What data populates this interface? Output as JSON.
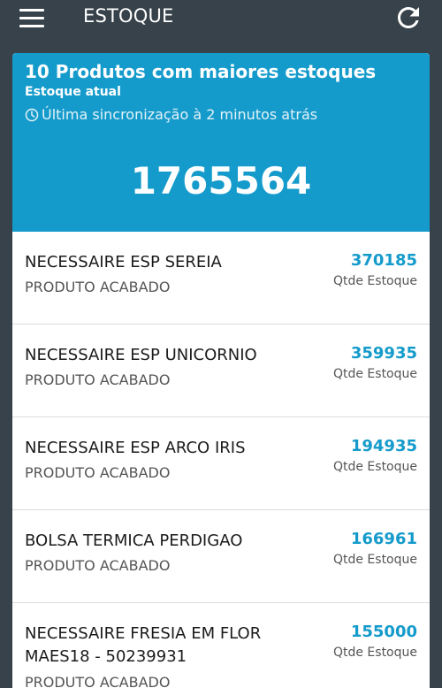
{
  "app": {
    "title": "ESTOQUE",
    "menu_icon": "hamburger-menu-icon",
    "refresh_icon": "refresh-icon"
  },
  "card": {
    "title": "10 Produtos com maiores estoques",
    "subtitle": "Estoque atual",
    "sync_text": "Última sincronização à 2 minutos atrás",
    "sync_icon": "clock-icon",
    "total": "1765564",
    "header_color": "#159bcb"
  },
  "products": [
    {
      "name": "NECESSAIRE ESP SEREIA",
      "type": "PRODUTO ACABADO",
      "qty": "370185",
      "qty_label": "Qtde Estoque"
    },
    {
      "name": "NECESSAIRE ESP UNICORNIO",
      "type": "PRODUTO ACABADO",
      "qty": "359935",
      "qty_label": "Qtde Estoque"
    },
    {
      "name": "NECESSAIRE ESP ARCO IRIS",
      "type": "PRODUTO ACABADO",
      "qty": "194935",
      "qty_label": "Qtde Estoque"
    },
    {
      "name": "BOLSA TERMICA PERDIGAO",
      "type": "PRODUTO ACABADO",
      "qty": "166961",
      "qty_label": "Qtde Estoque"
    },
    {
      "name": "NECESSAIRE FRESIA EM FLOR MAES18 - 50239931",
      "type": "PRODUTO ACABADO",
      "qty": "155000",
      "qty_label": "Qtde Estoque"
    }
  ]
}
